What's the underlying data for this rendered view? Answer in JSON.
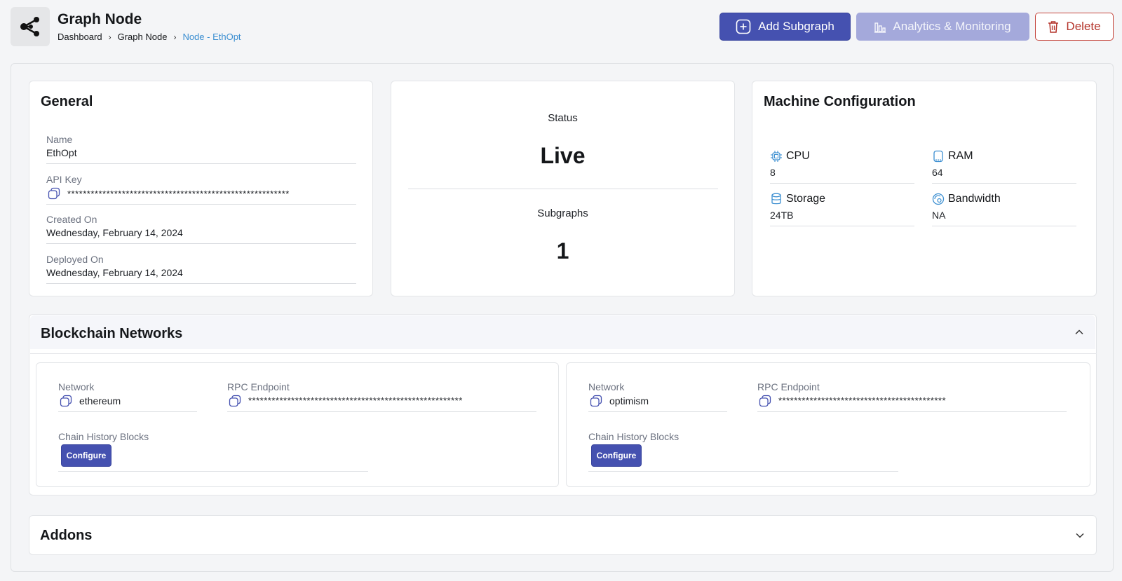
{
  "header": {
    "title": "Graph Node",
    "breadcrumb": [
      "Dashboard",
      "Graph Node",
      "Node - EthOpt"
    ],
    "buttons": {
      "add_subgraph": "Add Subgraph",
      "analytics": "Analytics & Monitoring",
      "delete": "Delete"
    }
  },
  "general": {
    "title": "General",
    "name_label": "Name",
    "name_value": "EthOpt",
    "api_key_label": "API Key",
    "api_key_value": "*********************************************************",
    "created_label": "Created On",
    "created_value": "Wednesday, February 14, 2024",
    "deployed_label": "Deployed On",
    "deployed_value": "Wednesday, February 14, 2024"
  },
  "status": {
    "status_label": "Status",
    "status_value": "Live",
    "subgraphs_label": "Subgraphs",
    "subgraphs_value": "1"
  },
  "machine": {
    "title": "Machine Configuration",
    "cpu_label": "CPU",
    "cpu_value": "8",
    "ram_label": "RAM",
    "ram_value": "64",
    "storage_label": "Storage",
    "storage_value": "24TB",
    "bandwidth_label": "Bandwidth",
    "bandwidth_value": "NA"
  },
  "blockchain": {
    "title": "Blockchain Networks",
    "networks": [
      {
        "network_label": "Network",
        "network_value": "ethereum",
        "rpc_label": "RPC Endpoint",
        "rpc_value": "*******************************************************",
        "chain_label": "Chain History Blocks",
        "configure_label": "Configure"
      },
      {
        "network_label": "Network",
        "network_value": "optimism",
        "rpc_label": "RPC Endpoint",
        "rpc_value": "*******************************************",
        "chain_label": "Chain History Blocks",
        "configure_label": "Configure"
      }
    ]
  },
  "addons": {
    "title": "Addons"
  },
  "colors": {
    "primary": "#4551b0",
    "primary_light": "#a4a9db",
    "danger": "#b4332a",
    "link": "#3c8fd1"
  }
}
